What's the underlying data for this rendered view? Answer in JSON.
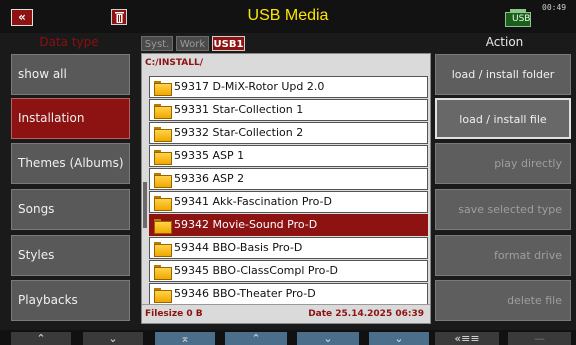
{
  "titlebar": {
    "title": "USB Media",
    "back_glyph": "«",
    "clock": "00:49",
    "usb_icon_label": "USB"
  },
  "headers": {
    "data_type": "Data type",
    "action": "Action"
  },
  "tabs": [
    {
      "label": "Syst."
    },
    {
      "label": "Work"
    },
    {
      "label": "USB1"
    }
  ],
  "data_types": [
    {
      "label": "show all"
    },
    {
      "label": "Installation"
    },
    {
      "label": "Themes (Albums)"
    },
    {
      "label": "Songs"
    },
    {
      "label": "Styles"
    },
    {
      "label": "Playbacks"
    }
  ],
  "browser": {
    "path": "C:/INSTALL/",
    "files": [
      {
        "name": "59317 D-MiX-Rotor Upd 2.0"
      },
      {
        "name": "59331 Star-Collection 1"
      },
      {
        "name": "59332 Star-Collection 2"
      },
      {
        "name": "59335 ASP 1"
      },
      {
        "name": "59336 ASP 2"
      },
      {
        "name": "59341 Akk-Fascination Pro-D"
      },
      {
        "name": "59342 Movie-Sound Pro-D"
      },
      {
        "name": "59344 BBO-Basis Pro-D"
      },
      {
        "name": "59345 BBO-ClassCompl Pro-D"
      },
      {
        "name": "59346 BBO-Theater Pro-D"
      }
    ],
    "filesize": "Filesize 0 B",
    "date": "Date 25.14.2025   06:39"
  },
  "actions": [
    {
      "label": "load  /  install folder"
    },
    {
      "label": "load  /  install file"
    },
    {
      "label": "play directly"
    },
    {
      "label": "save selected type"
    },
    {
      "label": "format drive"
    },
    {
      "label": "delete file"
    }
  ],
  "bottom_nav": [
    {
      "label": "⌃"
    },
    {
      "label": "⌄"
    },
    {
      "label": "⌅"
    },
    {
      "label": "⌃"
    },
    {
      "label": "⌄"
    },
    {
      "label": "⌄"
    },
    {
      "label": "«≡≡"
    },
    {
      "label": "—"
    }
  ],
  "colors": {
    "accent_red": "#8d1212",
    "title_yellow": "#ffe600"
  }
}
